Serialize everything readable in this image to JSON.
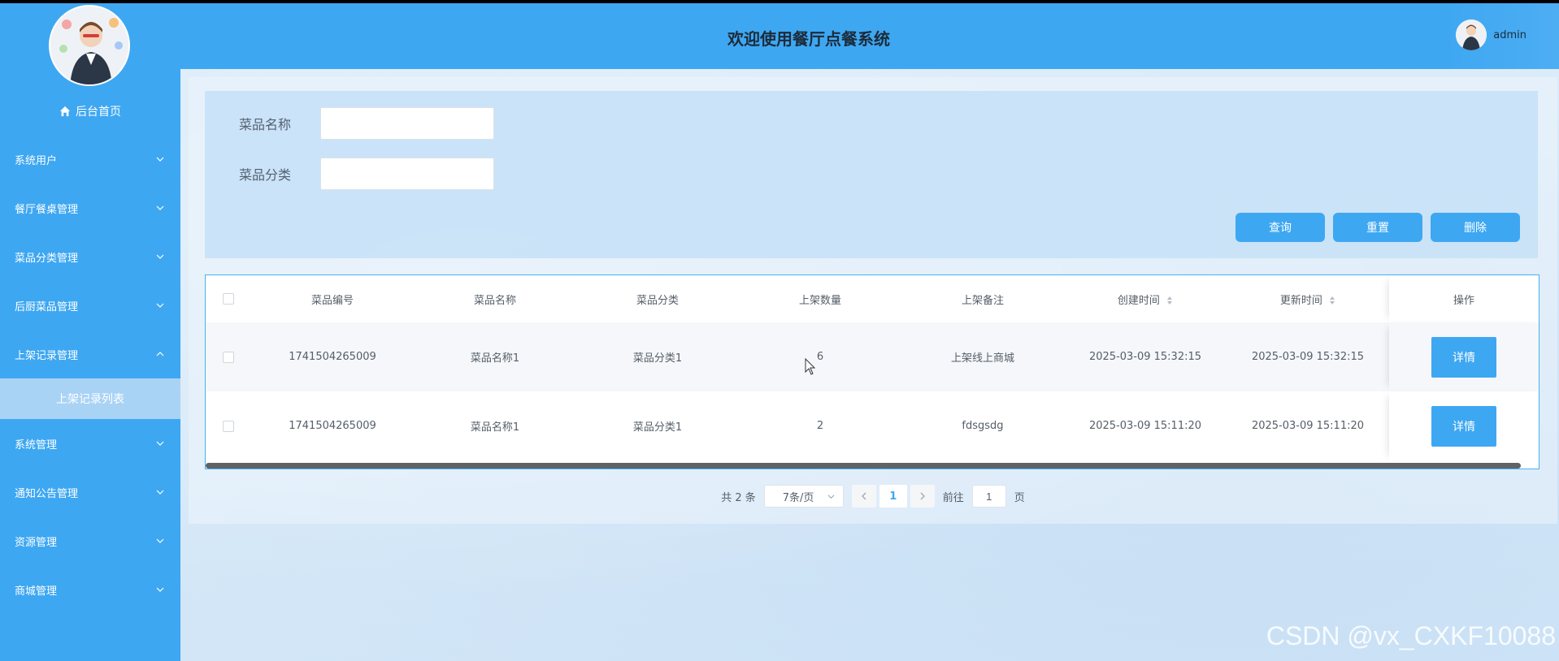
{
  "header": {
    "title": "欢迎使用餐厅点餐系统",
    "username": "admin"
  },
  "sidebar": {
    "home_label": "后台首页",
    "items": [
      {
        "label": "系统用户",
        "expanded": false
      },
      {
        "label": "餐厅餐桌管理",
        "expanded": false
      },
      {
        "label": "菜品分类管理",
        "expanded": false
      },
      {
        "label": "后厨菜品管理",
        "expanded": false
      },
      {
        "label": "上架记录管理",
        "expanded": true
      },
      {
        "label": "系统管理",
        "expanded": false
      },
      {
        "label": "通知公告管理",
        "expanded": false
      },
      {
        "label": "资源管理",
        "expanded": false
      },
      {
        "label": "商城管理",
        "expanded": false
      }
    ],
    "active_sub_item": "上架记录列表"
  },
  "search": {
    "name_label": "菜品名称",
    "name_value": "",
    "category_label": "菜品分类",
    "category_value": "",
    "query_label": "查询",
    "reset_label": "重置",
    "delete_label": "删除"
  },
  "table": {
    "columns": [
      "菜品编号",
      "菜品名称",
      "菜品分类",
      "上架数量",
      "上架备注",
      "创建时间",
      "更新时间",
      "操作"
    ],
    "rows": [
      {
        "id": "1741504265009",
        "name": "菜品名称1",
        "category": "菜品分类1",
        "quantity": "6",
        "remark": "上架线上商城",
        "created": "2025-03-09 15:32:15",
        "updated": "2025-03-09 15:32:15",
        "action": "详情"
      },
      {
        "id": "1741504265009",
        "name": "菜品名称1",
        "category": "菜品分类1",
        "quantity": "2",
        "remark": "fdsgsdg",
        "created": "2025-03-09 15:11:20",
        "updated": "2025-03-09 15:11:20",
        "action": "详情"
      }
    ]
  },
  "pager": {
    "total_text": "共 2 条",
    "page_size": "7条/页",
    "current_page": "1",
    "goto_label": "前往",
    "goto_value": "1",
    "page_suffix": "页"
  },
  "watermark": "CSDN @vx_CXKF10088",
  "colors": {
    "primary": "#3ea7f2",
    "sidebar_sub_active": "#a9d3f5",
    "background": "#d8eaf8"
  },
  "icons": {
    "home": "home-icon",
    "chevron_down": "chevron-down-icon",
    "chevron_up": "chevron-up-icon",
    "sort": "sort-icon"
  }
}
